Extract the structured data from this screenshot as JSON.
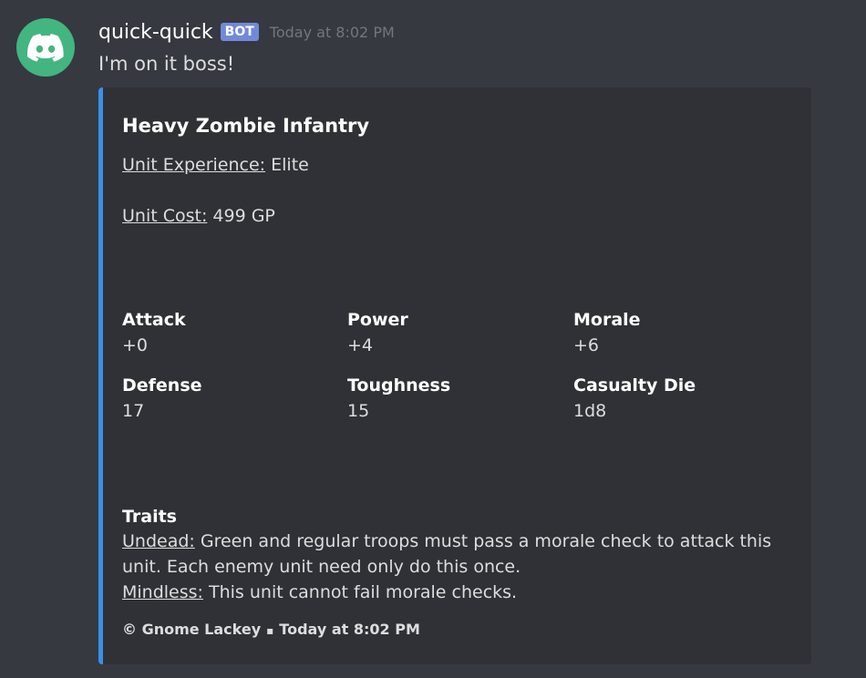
{
  "message": {
    "username": "quick-quick",
    "bot_tag": "BOT",
    "timestamp": "Today at 8:02 PM",
    "content": "I'm on it boss!",
    "avatar_icon": "discord-logo-icon",
    "avatar_color": "#43b581"
  },
  "embed": {
    "accent_color": "#3b8fe8",
    "title": "Heavy Zombie Infantry",
    "experience_label": "Unit Experience:",
    "experience_value": "Elite",
    "cost_label": "Unit Cost:",
    "cost_value": "499 GP",
    "fields": [
      {
        "name": "Attack",
        "value": "+0"
      },
      {
        "name": "Power",
        "value": "+4"
      },
      {
        "name": "Morale",
        "value": "+6"
      },
      {
        "name": "Defense",
        "value": "17"
      },
      {
        "name": "Toughness",
        "value": "15"
      },
      {
        "name": "Casualty Die",
        "value": "1d8"
      }
    ],
    "traits": {
      "heading": "Traits",
      "undead_label": "Undead:",
      "undead_text_1": "Green and regular troops must pass a morale check to attack this",
      "undead_text_2": "unit. Each enemy unit need only do this once.",
      "mindless_label": "Mindless:",
      "mindless_text": "This unit cannot fail morale checks."
    },
    "footer": {
      "text": "© Gnome Lackey",
      "separator": "▪",
      "timestamp": "Today at 8:02 PM"
    }
  }
}
